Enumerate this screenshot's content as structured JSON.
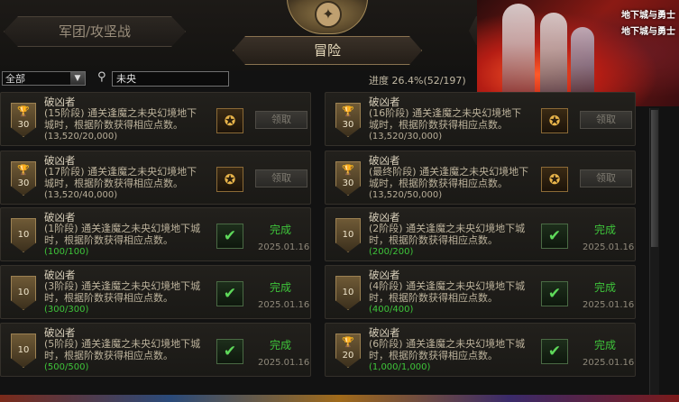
{
  "header": {
    "tab_left": "军团/攻坚战",
    "tab_center": "冒险"
  },
  "banner": {
    "logo_top": "地下城与勇士",
    "logo_bottom": "地下城与勇士"
  },
  "filter": {
    "select_value": "全部",
    "search_value": "未央",
    "progress": "进度 26.4%(52/197)"
  },
  "cards": [
    {
      "title": "破凶者",
      "desc": "(15阶段) 通关逢魔之未央幻境地下城时，根据阶数获得相应点数。",
      "progress": "(13,520/20,000)",
      "points": "30",
      "status": "claim",
      "button": "领取"
    },
    {
      "title": "破凶者",
      "desc": "(16阶段) 通关逢魔之未央幻境地下城时，根据阶数获得相应点数。",
      "progress": "(13,520/30,000)",
      "points": "30",
      "status": "claim",
      "button": "领取"
    },
    {
      "title": "破凶者",
      "desc": "(17阶段) 通关逢魔之未央幻境地下城时，根据阶数获得相应点数。",
      "progress": "(13,520/40,000)",
      "points": "30",
      "status": "claim",
      "button": "领取"
    },
    {
      "title": "破凶者",
      "desc": "(最终阶段) 通关逢魔之未央幻境地下城时，根据阶数获得相应点数。",
      "progress": "(13,520/50,000)",
      "points": "30",
      "status": "claim",
      "button": "领取"
    },
    {
      "title": "破凶者",
      "desc": "(1阶段) 通关逢魔之未央幻境地下城时，根据阶数获得相应点数。",
      "progress": "(100/100)",
      "points": "10",
      "status": "done",
      "done_label": "完成",
      "date": "2025.01.16"
    },
    {
      "title": "破凶者",
      "desc": "(2阶段) 通关逢魔之未央幻境地下城时，根据阶数获得相应点数。",
      "progress": "(200/200)",
      "points": "10",
      "status": "done",
      "done_label": "完成",
      "date": "2025.01.16"
    },
    {
      "title": "破凶者",
      "desc": "(3阶段) 通关逢魔之未央幻境地下城时，根据阶数获得相应点数。",
      "progress": "(300/300)",
      "points": "10",
      "status": "done",
      "done_label": "完成",
      "date": "2025.01.16"
    },
    {
      "title": "破凶者",
      "desc": "(4阶段) 通关逢魔之未央幻境地下城时，根据阶数获得相应点数。",
      "progress": "(400/400)",
      "points": "10",
      "status": "done",
      "done_label": "完成",
      "date": "2025.01.16"
    },
    {
      "title": "破凶者",
      "desc": "(5阶段) 通关逢魔之未央幻境地下城时，根据阶数获得相应点数。",
      "progress": "(500/500)",
      "points": "10",
      "status": "done",
      "done_label": "完成",
      "date": "2025.01.16"
    },
    {
      "title": "破凶者",
      "desc": "(6阶段) 通关逢魔之未央幻境地下城时，根据阶数获得相应点数。",
      "progress": "(1,000/1,000)",
      "points": "20",
      "status": "done",
      "done_label": "完成",
      "date": "2025.01.16"
    }
  ],
  "icons": {
    "trophy": "trophy-icon",
    "reward": "reward-emblem-icon",
    "check": "checkmark-icon",
    "search": "search-icon"
  },
  "colors": {
    "complete_green": "#3ec43a",
    "gold_border": "#8a7350"
  }
}
